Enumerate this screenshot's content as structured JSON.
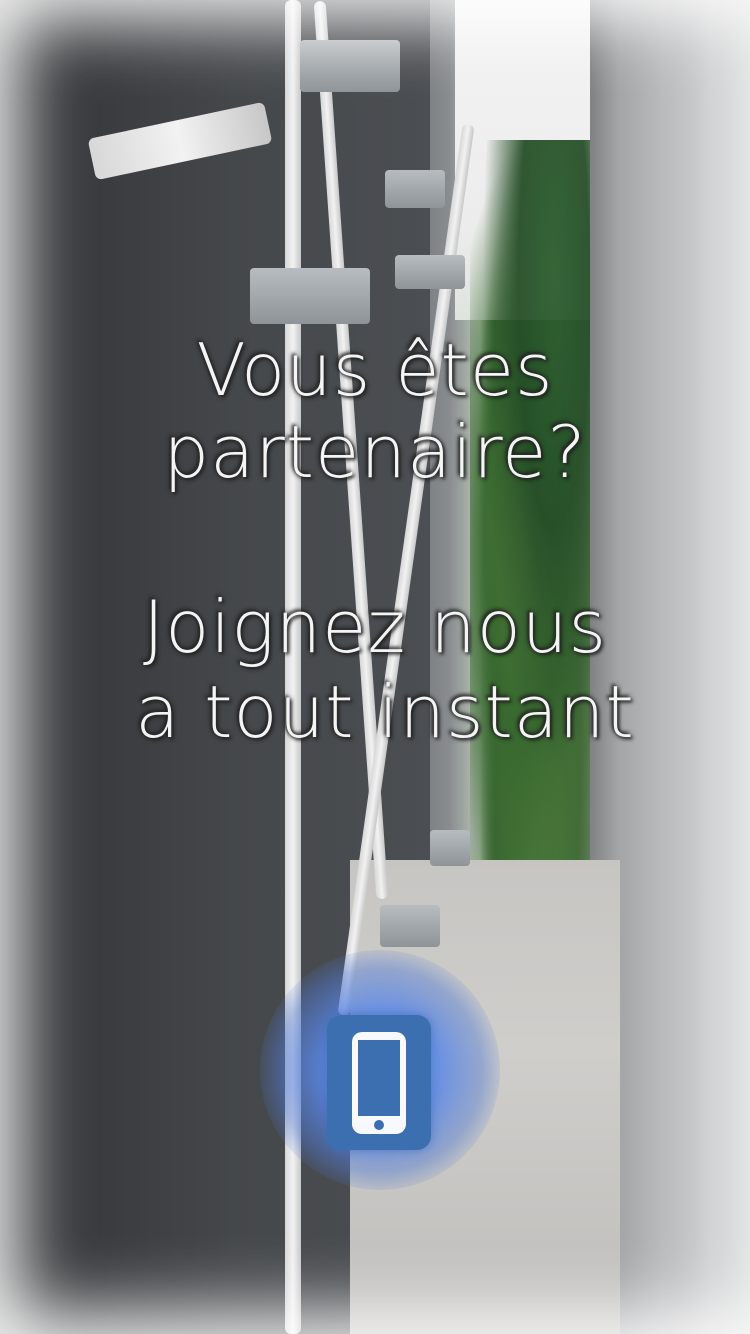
{
  "promo": {
    "line1": "Vous êtes",
    "line2": "partenaire?",
    "line3": "Joignez nous",
    "line4": "a tout instant"
  },
  "contact": {
    "icon": "smartphone-icon",
    "accent_color": "#3c6fb0",
    "glow_color": "#7aa7f5"
  }
}
